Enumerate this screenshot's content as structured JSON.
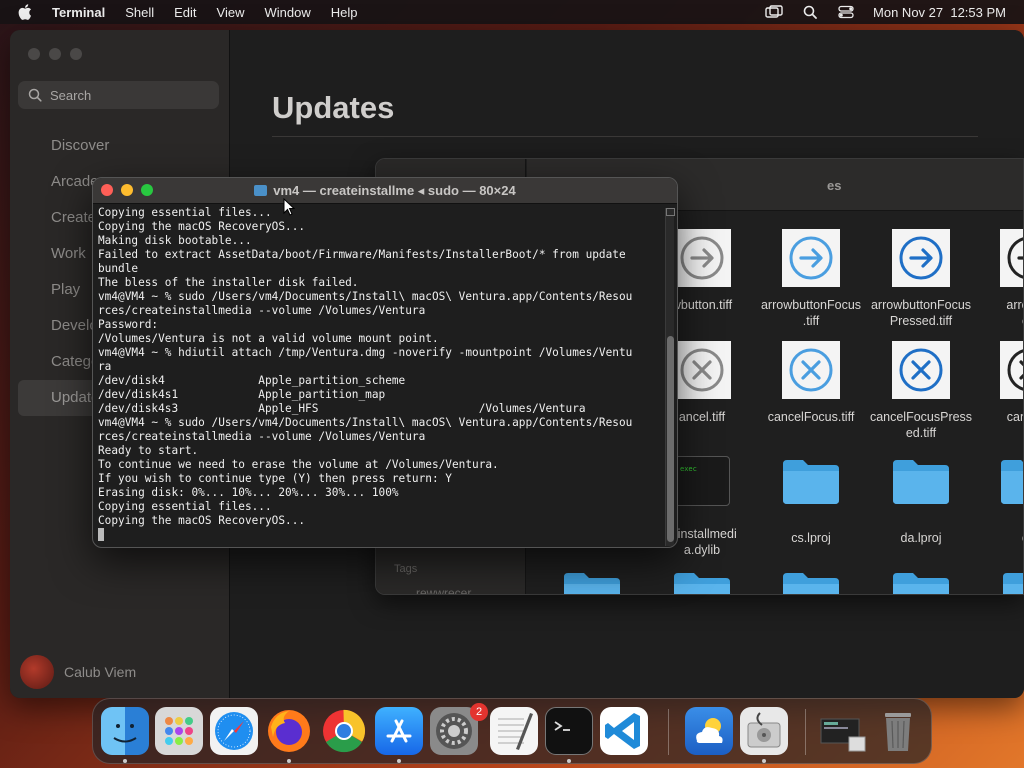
{
  "menubar": {
    "app_name": "Terminal",
    "items": [
      "Shell",
      "Edit",
      "View",
      "Window",
      "Help"
    ],
    "datetime": "Mon Nov 27  12:53 PM"
  },
  "appstore": {
    "search_placeholder": "Search",
    "nav": [
      "Discover",
      "Arcade",
      "Create",
      "Work",
      "Play",
      "Develop",
      "Categories",
      "Updates"
    ],
    "active_nav": "Updates",
    "page_title": "Updates",
    "account_name": "Calub Viem"
  },
  "finder": {
    "title_partial": "es",
    "tags_label": "Tags",
    "tag_item": "rewwrecer",
    "files": [
      {
        "name": "wbutton.tiff",
        "kind": "arrow-gray"
      },
      {
        "name": "arrowbuttonFocus\n.tiff",
        "kind": "arrow-blue"
      },
      {
        "name": "arrowbuttonFocus\nPressed.tiff",
        "kind": "arrow-blue-dark"
      },
      {
        "name": "arrowbu\ned",
        "kind": "arrow-black"
      },
      {
        "name": "ancel.tiff",
        "kind": "x-gray"
      },
      {
        "name": "cancelFocus.tiff",
        "kind": "x-blue"
      },
      {
        "name": "cancelFocusPress\ned.tiff",
        "kind": "x-blue-dark"
      },
      {
        "name": "cancelP",
        "kind": "x-black"
      },
      {
        "name": "teinstallmedi\na.dylib",
        "kind": "dylib"
      },
      {
        "name": "cs.lproj",
        "kind": "folder"
      },
      {
        "name": "da.lproj",
        "kind": "folder"
      },
      {
        "name": "de",
        "kind": "folder"
      }
    ],
    "dylib_label": "exec"
  },
  "terminal": {
    "title": "vm4 — createinstallme ◂ sudo — 80×24",
    "lines": [
      "Copying essential files...",
      "Copying the macOS RecoveryOS...",
      "Making disk bootable...",
      "Failed to extract AssetData/boot/Firmware/Manifests/InstallerBoot/* from update",
      "bundle",
      "The bless of the installer disk failed.",
      "vm4@VM4 ~ % sudo /Users/vm4/Documents/Install\\ macOS\\ Ventura.app/Contents/Resou",
      "rces/createinstallmedia --volume /Volumes/Ventura",
      "Password:",
      "/Volumes/Ventura is not a valid volume mount point.",
      "vm4@VM4 ~ % hdiutil attach /tmp/Ventura.dmg -noverify -mountpoint /Volumes/Ventu",
      "ra",
      "/dev/disk4              Apple_partition_scheme",
      "/dev/disk4s1            Apple_partition_map",
      "/dev/disk4s3            Apple_HFS                        /Volumes/Ventura",
      "vm4@VM4 ~ % sudo /Users/vm4/Documents/Install\\ macOS\\ Ventura.app/Contents/Resou",
      "rces/createinstallmedia --volume /Volumes/Ventura",
      "Ready to start.",
      "To continue we need to erase the volume at /Volumes/Ventura.",
      "If you wish to continue type (Y) then press return: Y",
      "Erasing disk: 0%... 10%... 20%... 30%... 100%",
      "Copying essential files...",
      "Copying the macOS RecoveryOS..."
    ]
  },
  "dock": {
    "apps": [
      "Finder",
      "Launchpad",
      "Safari",
      "Firefox",
      "Chrome",
      "App Store",
      "System Settings",
      "TextEdit",
      "Terminal",
      "Visual Studio Code",
      "Weather",
      "Disk Utility",
      "Downloads",
      "Trash"
    ],
    "system_settings_badge": "2"
  },
  "colors": {
    "accent_blue": "#2f80d8",
    "folder_blue": "#5ab4ec",
    "traffic_red": "#ff5f57",
    "traffic_yellow": "#febc2e",
    "traffic_green": "#28c840"
  }
}
